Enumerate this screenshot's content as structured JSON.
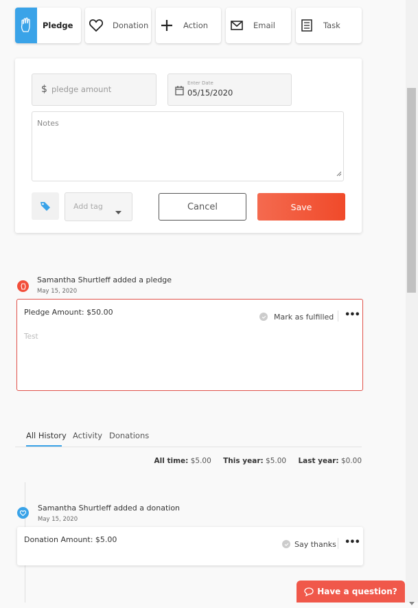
{
  "tabs": [
    {
      "label": "Pledge",
      "icon": "hand-icon",
      "active": true
    },
    {
      "label": "Donation",
      "icon": "heart-icon"
    },
    {
      "label": "Action",
      "icon": "plus-icon"
    },
    {
      "label": "Email",
      "icon": "envelope-icon"
    },
    {
      "label": "Task",
      "icon": "checklist-icon"
    }
  ],
  "form": {
    "amount_symbol": "$",
    "amount_placeholder": "pledge amount",
    "date_label": "Enter Date",
    "date_value": "05/15/2020",
    "notes_placeholder": "Notes",
    "tag_placeholder": "Add tag",
    "cancel_label": "Cancel",
    "save_label": "Save"
  },
  "pledge_event": {
    "title": "Samantha Shurtleff added a pledge",
    "date": "May 15, 2020",
    "amount_text": "Pledge Amount: $50.00",
    "action_label": "Mark as fulfilled",
    "note": "Test"
  },
  "history_tabs": [
    "All History",
    "Activity",
    "Donations"
  ],
  "stats": {
    "all_time_label": "All time:",
    "all_time_value": "$5.00",
    "this_year_label": "This year:",
    "this_year_value": "$5.00",
    "last_year_label": "Last year:",
    "last_year_value": "$0.00"
  },
  "donation_event": {
    "title": "Samantha Shurtleff added a donation",
    "date": "May 15, 2020",
    "amount_text": "Donation Amount: $5.00",
    "action_label": "Say thanks"
  },
  "chat": {
    "label": "Have a question?"
  },
  "colors": {
    "accent_blue": "#3aa3e8",
    "save_red": "#f4533b",
    "pledge_border": "#e0524a"
  }
}
